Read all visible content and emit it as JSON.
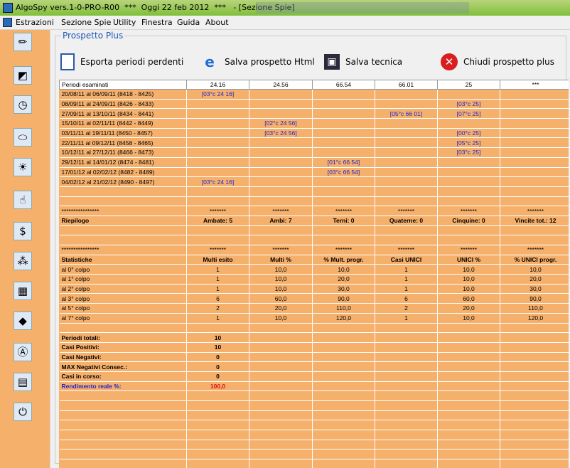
{
  "window": {
    "title": "AlgoSpy vers.1-0-PRO-R00  ***  Oggi 22 feb 2012  ***   - [Sezione Spie]"
  },
  "menu": [
    "Estrazioni",
    "Sezione Spie",
    "Utility",
    "Finestra",
    "Guida",
    "About"
  ],
  "sidebar": {
    "tools": [
      {
        "icon": "pencil-icon"
      },
      {
        "icon": "eraser-icon"
      },
      {
        "icon": "clock-icon"
      },
      {
        "icon": "pills-icon"
      },
      {
        "icon": "lightbulb-icon"
      },
      {
        "icon": "hand-icon"
      },
      {
        "icon": "dollar-icon"
      },
      {
        "icon": "network-icon"
      },
      {
        "icon": "calendar-icon"
      },
      {
        "icon": "diamond-icon"
      },
      {
        "icon": "letter-a-icon"
      },
      {
        "icon": "book-icon"
      },
      {
        "icon": "power-icon"
      }
    ]
  },
  "panel": {
    "title": "Prospetto Plus"
  },
  "toolbar": {
    "export_label": "Esporta periodi perdenti",
    "save_html_label": "Salva prospetto Html",
    "save_tech_label": "Salva tecnica",
    "close_label": "Chiudi prospetto plus"
  },
  "grid": {
    "headers": [
      "Periodi esaminati",
      "24.16",
      "24.56",
      "66.54",
      "66.01",
      "25",
      "***"
    ],
    "periods": [
      [
        "20/08/11 al 06/09/11  (8418 - 8425)",
        "[03°c 24 16]",
        "",
        "",
        "",
        "",
        ""
      ],
      [
        "08/09/11 al 24/09/11  (8426 - 8433)",
        "",
        "",
        "",
        "",
        "[03°c 25]",
        ""
      ],
      [
        "27/09/11 al 13/10/11  (8434 - 8441)",
        "",
        "",
        "",
        "[05°c 66 01]",
        "[07°c 25]",
        ""
      ],
      [
        "15/10/11 al 02/11/11  (8442 - 8449)",
        "",
        "[02°c 24 56]",
        "",
        "",
        "",
        ""
      ],
      [
        "03/11/11 al 19/11/11  (8450 - 8457)",
        "",
        "[03°c 24 56]",
        "",
        "",
        "[00°c 25]",
        ""
      ],
      [
        "22/11/11 al 09/12/11  (8458 - 8465)",
        "",
        "",
        "",
        "",
        "[05°c 25]",
        ""
      ],
      [
        "10/12/11 al 27/12/11  (8466 - 8473)",
        "",
        "",
        "",
        "",
        "[03°c 25]",
        ""
      ],
      [
        "29/12/11 al 14/01/12  (8474 - 8481)",
        "",
        "",
        "[01°c 66 54]",
        "",
        "",
        ""
      ],
      [
        "17/01/12 al 02/02/12  (8482 - 8489)",
        "",
        "",
        "[03°c 66 54]",
        "",
        "",
        ""
      ],
      [
        "04/02/12 al 21/02/12  (8490 - 8497)",
        "[03°c 24 16]",
        "",
        "",
        "",
        "",
        ""
      ]
    ],
    "separator_long": "****************",
    "separator_short": "*******",
    "riepilogo": [
      "Riepilogo",
      "Ambate: 5",
      "Ambi: 7",
      "Terni: 0",
      "Quaterne: 0",
      "Cinquine: 0",
      "Vincite tot.: 12"
    ],
    "stat_headers": [
      "Statistiche",
      "Multi esito",
      "Multi %",
      "% Mult. progr.",
      "Casi UNICI",
      "UNICI %",
      "% UNICI progr."
    ],
    "stats": [
      [
        "al 0° colpo",
        "1",
        "10,0",
        "10,0",
        "1",
        "10,0",
        "10,0"
      ],
      [
        "al 1° colpo",
        "1",
        "10,0",
        "20,0",
        "1",
        "10,0",
        "20,0"
      ],
      [
        "al 2° colpo",
        "1",
        "10,0",
        "30,0",
        "1",
        "10,0",
        "30,0"
      ],
      [
        "al 3° colpo",
        "6",
        "60,0",
        "90,0",
        "6",
        "60,0",
        "90,0"
      ],
      [
        "al 5° colpo",
        "2",
        "20,0",
        "110,0",
        "2",
        "20,0",
        "110,0"
      ],
      [
        "al 7° colpo",
        "1",
        "10,0",
        "120,0",
        "1",
        "10,0",
        "120,0"
      ]
    ],
    "summary": [
      [
        "Periodi totali:",
        "10"
      ],
      [
        "Casi Positivi:",
        "10"
      ],
      [
        "Casi Negativi:",
        "0"
      ],
      [
        "MAX Negativi Consec.:",
        "0"
      ],
      [
        "Casi in corso:",
        "0"
      ],
      [
        "Rendimento reale %:",
        "100,0"
      ]
    ]
  }
}
